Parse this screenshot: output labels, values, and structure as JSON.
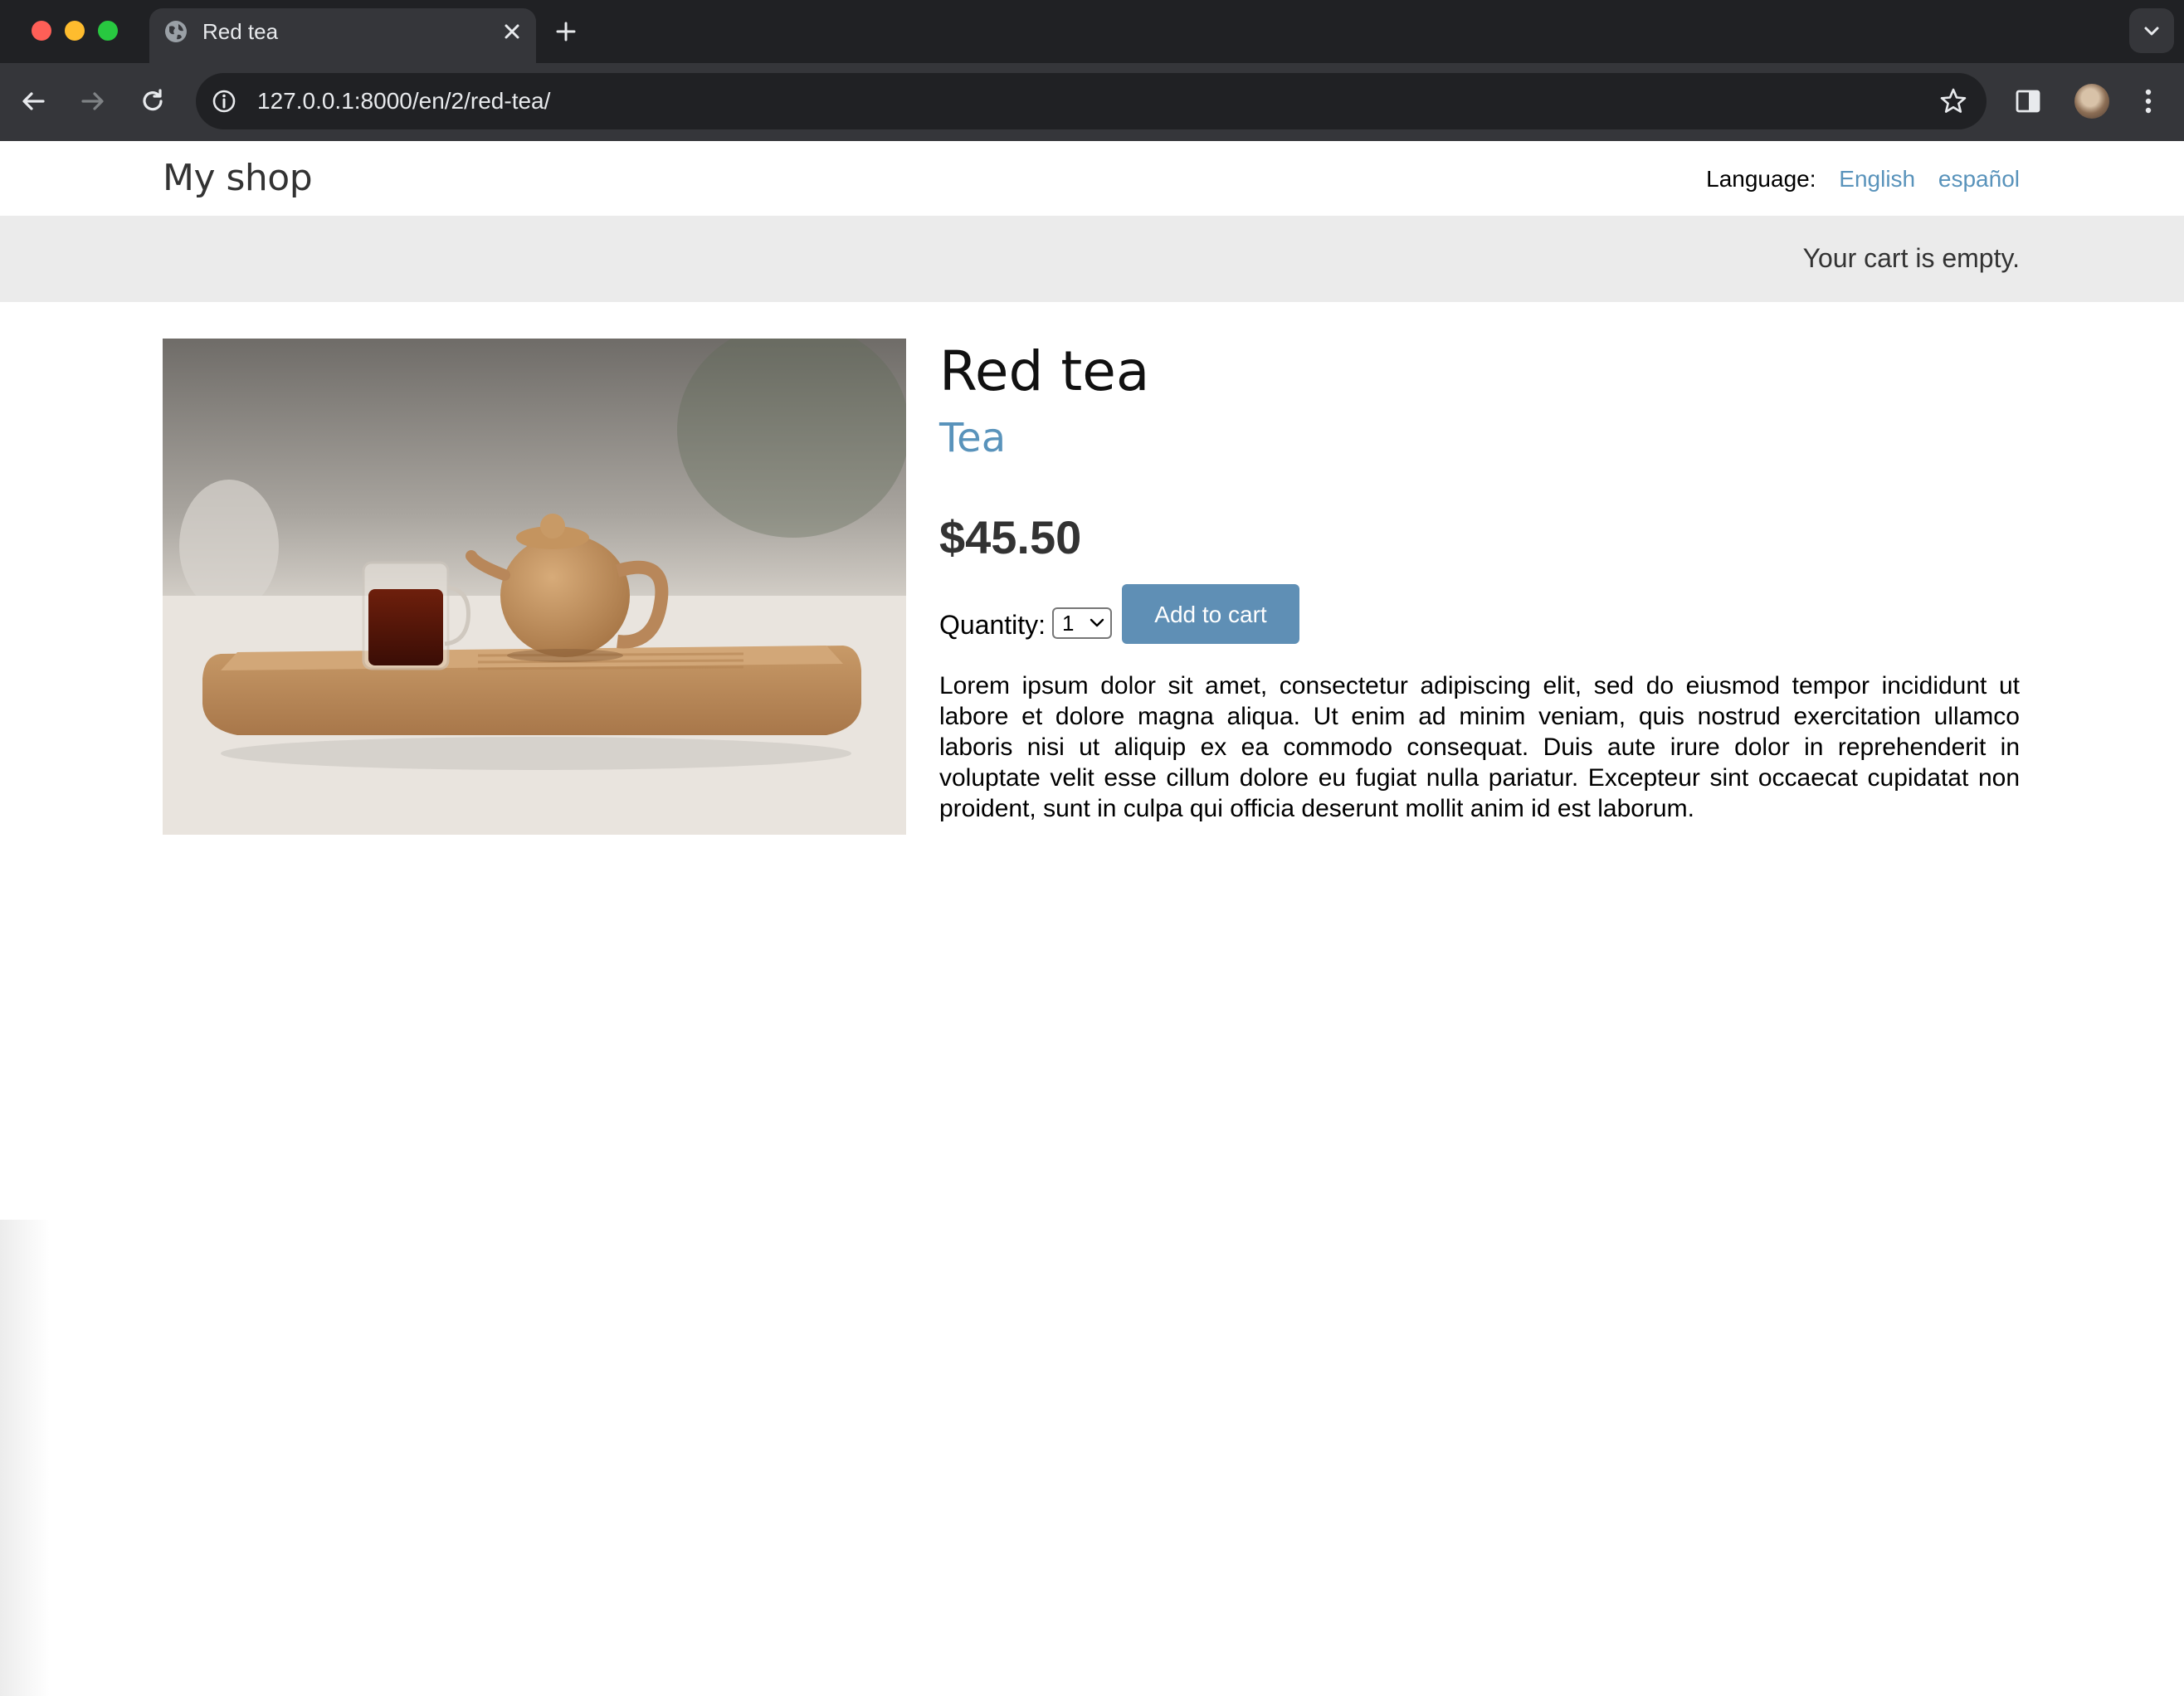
{
  "browser": {
    "tab_title": "Red tea",
    "url": "127.0.0.1:8000/en/2/red-tea/",
    "icons": [
      "globe-icon",
      "close-icon",
      "plus-icon",
      "chevron-down-icon",
      "back-arrow-icon",
      "forward-arrow-icon",
      "reload-icon",
      "info-icon",
      "star-icon",
      "side-panel-icon",
      "kebab-menu-icon"
    ]
  },
  "header": {
    "site_title": "My shop",
    "language_label": "Language:",
    "languages": [
      {
        "label": "English"
      },
      {
        "label": "español"
      }
    ]
  },
  "cart": {
    "status": "Your cart is empty."
  },
  "product": {
    "name": "Red tea",
    "category": "Tea",
    "price": "$45.50",
    "quantity_label": "Quantity:",
    "quantity_value": "1",
    "add_to_cart_label": "Add to cart",
    "description": "Lorem ipsum dolor sit amet, consectetur adipiscing elit, sed do eiusmod tempor incididunt ut labore et dolore magna aliqua. Ut enim ad minim veniam, quis nostrud exercitation ullamco laboris nisi ut aliquip ex ea commodo consequat. Duis aute irure dolor in reprehenderit in voluptate velit esse cillum dolore eu fugiat nulla pariatur. Excepteur sint occaecat cupidatat non proident, sunt in culpa qui officia deserunt mollit anim id est laborum."
  },
  "colors": {
    "link": "#5993bb",
    "button": "#5f8fb5",
    "cart_bar": "#ebebeb"
  }
}
